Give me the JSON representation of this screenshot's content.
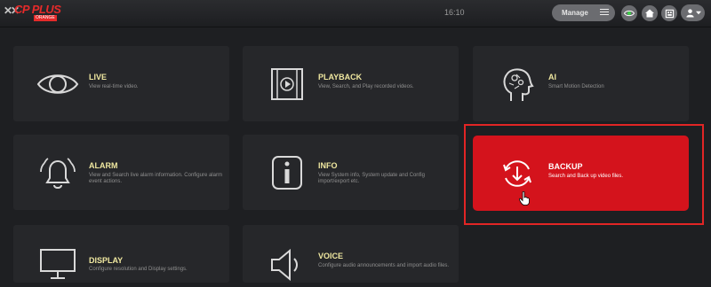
{
  "header": {
    "logo_text": "CP PLUS",
    "logo_sub": "ORANGE",
    "time": "16:10",
    "manage_label": "Manage"
  },
  "tiles": [
    {
      "title": "LIVE",
      "desc": "View real-time video.",
      "icon": "eye-icon"
    },
    {
      "title": "PLAYBACK",
      "desc": "View, Search, and Play recorded videos.",
      "icon": "film-play-icon"
    },
    {
      "title": "AI",
      "desc": "Smart Motion Detection",
      "icon": "ai-head-icon"
    },
    {
      "title": "ALARM",
      "desc": "View and Search live alarm information. Configure alarm event actions.",
      "icon": "alarm-bell-icon"
    },
    {
      "title": "INFO",
      "desc": "View System info, System update and Config import/export etc.",
      "icon": "info-icon"
    },
    {
      "title": "BACKUP",
      "desc": "Search and Back up video files.",
      "icon": "backup-icon"
    },
    {
      "title": "DISPLAY",
      "desc": "Configure resolution and Display settings.",
      "icon": "monitor-icon"
    },
    {
      "title": "VOICE",
      "desc": "Configure audio announcements and import audio files.",
      "icon": "speaker-icon"
    }
  ],
  "colors": {
    "accent": "#d4131c",
    "highlight": "#e22525",
    "tile_bg": "#26272a",
    "title": "#f0e8a0"
  }
}
